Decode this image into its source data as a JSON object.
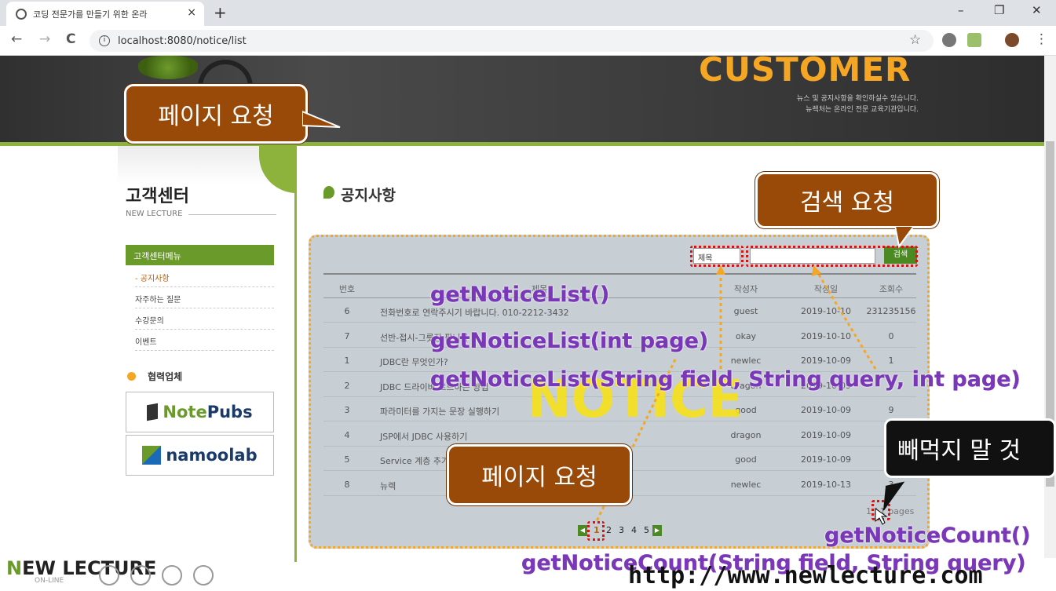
{
  "browser": {
    "tab_title": "코딩 전문가를 만들기 위한 온라",
    "tab_close": "×",
    "new_tab": "+",
    "url": "localhost:8080/notice/list",
    "win_min": "–",
    "win_max": "❐",
    "win_close": "✕",
    "back": "←",
    "forward": "→",
    "reload": "C",
    "star": "☆",
    "menu": "⋮"
  },
  "hero": {
    "brand": "CUSTOMER",
    "line1": "뉴스 및 공지사항을 확인하실수 있습니다.",
    "line2": "뉴렉처는 온라인 전문 교육기관입니다."
  },
  "sidebar": {
    "title": "고객센터",
    "subtitle": "NEW LECTURE",
    "menu_title": "고객센터메뉴",
    "items": [
      {
        "label": "- 공지사항"
      },
      {
        "label": "자주하는 질문"
      },
      {
        "label": "수강문의"
      },
      {
        "label": "이벤트"
      }
    ],
    "partner_label": "협력업체",
    "partner1_a": "Note",
    "partner1_b": "Pubs",
    "partner2_a": "namoo",
    "partner2_b": "lab"
  },
  "board": {
    "title": "공지사항",
    "search_field": "제목",
    "search_button": "검색",
    "columns": [
      "번호",
      "제목",
      "작성자",
      "작성일",
      "조회수"
    ],
    "rows": [
      {
        "no": "6",
        "title": "전화번호로 연락주시기 바랍니다. 010-2212-3432",
        "writer": "guest",
        "date": "2019-10-10",
        "hit": "231235156"
      },
      {
        "no": "7",
        "title": "선반-접시-그릇장 팝니다",
        "writer": "okay",
        "date": "2019-10-10",
        "hit": "0"
      },
      {
        "no": "1",
        "title": "JDBC란 무엇인가?",
        "writer": "newlec",
        "date": "2019-10-09",
        "hit": "1"
      },
      {
        "no": "2",
        "title": "JDBC 드라이버 로드하는 방법",
        "writer": "dragon",
        "date": "2019-10-09",
        "hit": ""
      },
      {
        "no": "3",
        "title": "파라미터를 가지는 문장 실행하기",
        "writer": "good",
        "date": "2019-10-09",
        "hit": "9"
      },
      {
        "no": "4",
        "title": "JSP에서 JDBC 사용하기",
        "writer": "dragon",
        "date": "2019-10-09",
        "hit": ""
      },
      {
        "no": "5",
        "title": "Service 계층 추가하기",
        "writer": "good",
        "date": "2019-10-09",
        "hit": ""
      },
      {
        "no": "8",
        "title": "뉴렉",
        "writer": "newlec",
        "date": "2019-10-13",
        "hit": "3"
      }
    ],
    "pages_info": "1 / 1 pages",
    "pages": [
      "1",
      "2",
      "3",
      "4",
      "5"
    ],
    "prev": "◀",
    "next": "▶",
    "watermark": "NOTICE"
  },
  "annotations": {
    "callout_page_top": "페이지 요청",
    "callout_search": "검색 요청",
    "callout_page_bottom": "페이지 요청",
    "callout_dont_miss": "빼먹지 말 것",
    "method1": "getNoticeList()",
    "method2": "getNoticeList(int page)",
    "method3": "getNoticeList(String field, String query, int page)",
    "method4": "getNoticeCount()",
    "method5": "getNoticeCount(String field, String query)",
    "arrow_color": "#f5a623",
    "callout_color": "#9a4a08",
    "method_color": "#7a38b8"
  },
  "footer": {
    "logo_a": "N",
    "logo_b": "EW LECTURE",
    "logo_sub": "ON-LINE",
    "url": "http://www.newlecture.com"
  }
}
